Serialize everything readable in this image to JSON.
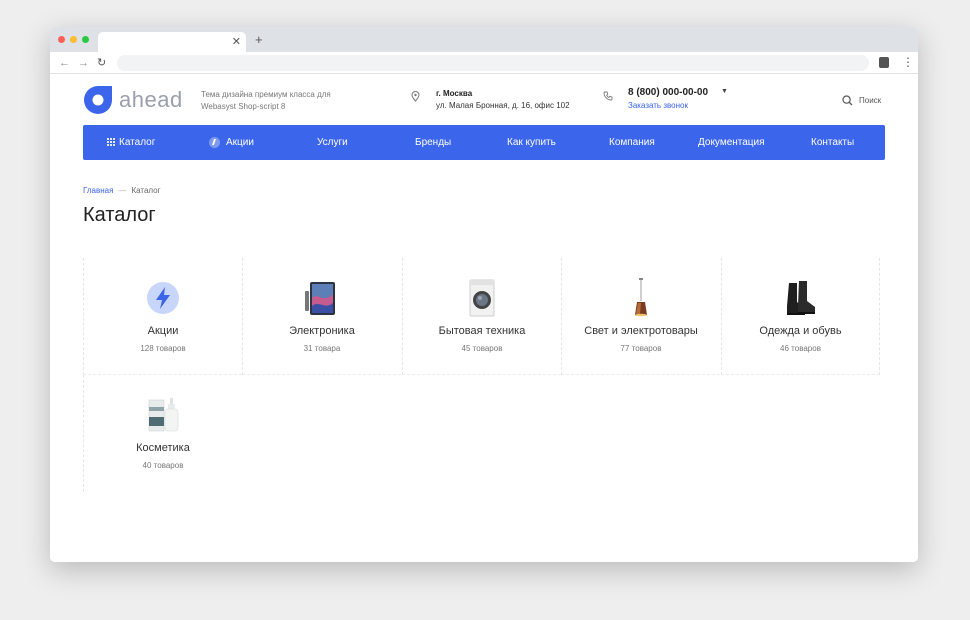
{
  "header": {
    "logo_text": "ahead",
    "tagline": "Тема дизайна премиум класса для Webasyst Shop-script 8",
    "city": "г. Москва",
    "address": "ул. Малая Бронная, д. 16, офис 102",
    "phone": "8 (800) 000-00-00",
    "callback": "Заказать звонок",
    "search": "Поиск"
  },
  "nav": {
    "items": [
      {
        "label": "Каталог"
      },
      {
        "label": "Акции"
      },
      {
        "label": "Услуги"
      },
      {
        "label": "Бренды"
      },
      {
        "label": "Как купить"
      },
      {
        "label": "Компания"
      },
      {
        "label": "Документация"
      },
      {
        "label": "Контакты"
      }
    ]
  },
  "breadcrumb": {
    "home": "Главная",
    "separator": "—",
    "current": "Каталог"
  },
  "page": {
    "title": "Каталог"
  },
  "catalog": {
    "categories": [
      {
        "name": "Акции",
        "count": "128 товаров",
        "icon": "lightning-icon"
      },
      {
        "name": "Электроника",
        "count": "31 товара",
        "icon": "tablet-icon"
      },
      {
        "name": "Бытовая техника",
        "count": "45 товаров",
        "icon": "washing-machine-icon"
      },
      {
        "name": "Свет и электротовары",
        "count": "77 товаров",
        "icon": "pendant-lamp-icon"
      },
      {
        "name": "Одежда и обувь",
        "count": "46 товаров",
        "icon": "boots-icon"
      },
      {
        "name": "Косметика",
        "count": "40 товаров",
        "icon": "cosmetics-icon"
      }
    ]
  },
  "colors": {
    "accent": "#3b65ea",
    "nav_text": "#ffffff",
    "promo_circle": "#c9d6fb"
  }
}
